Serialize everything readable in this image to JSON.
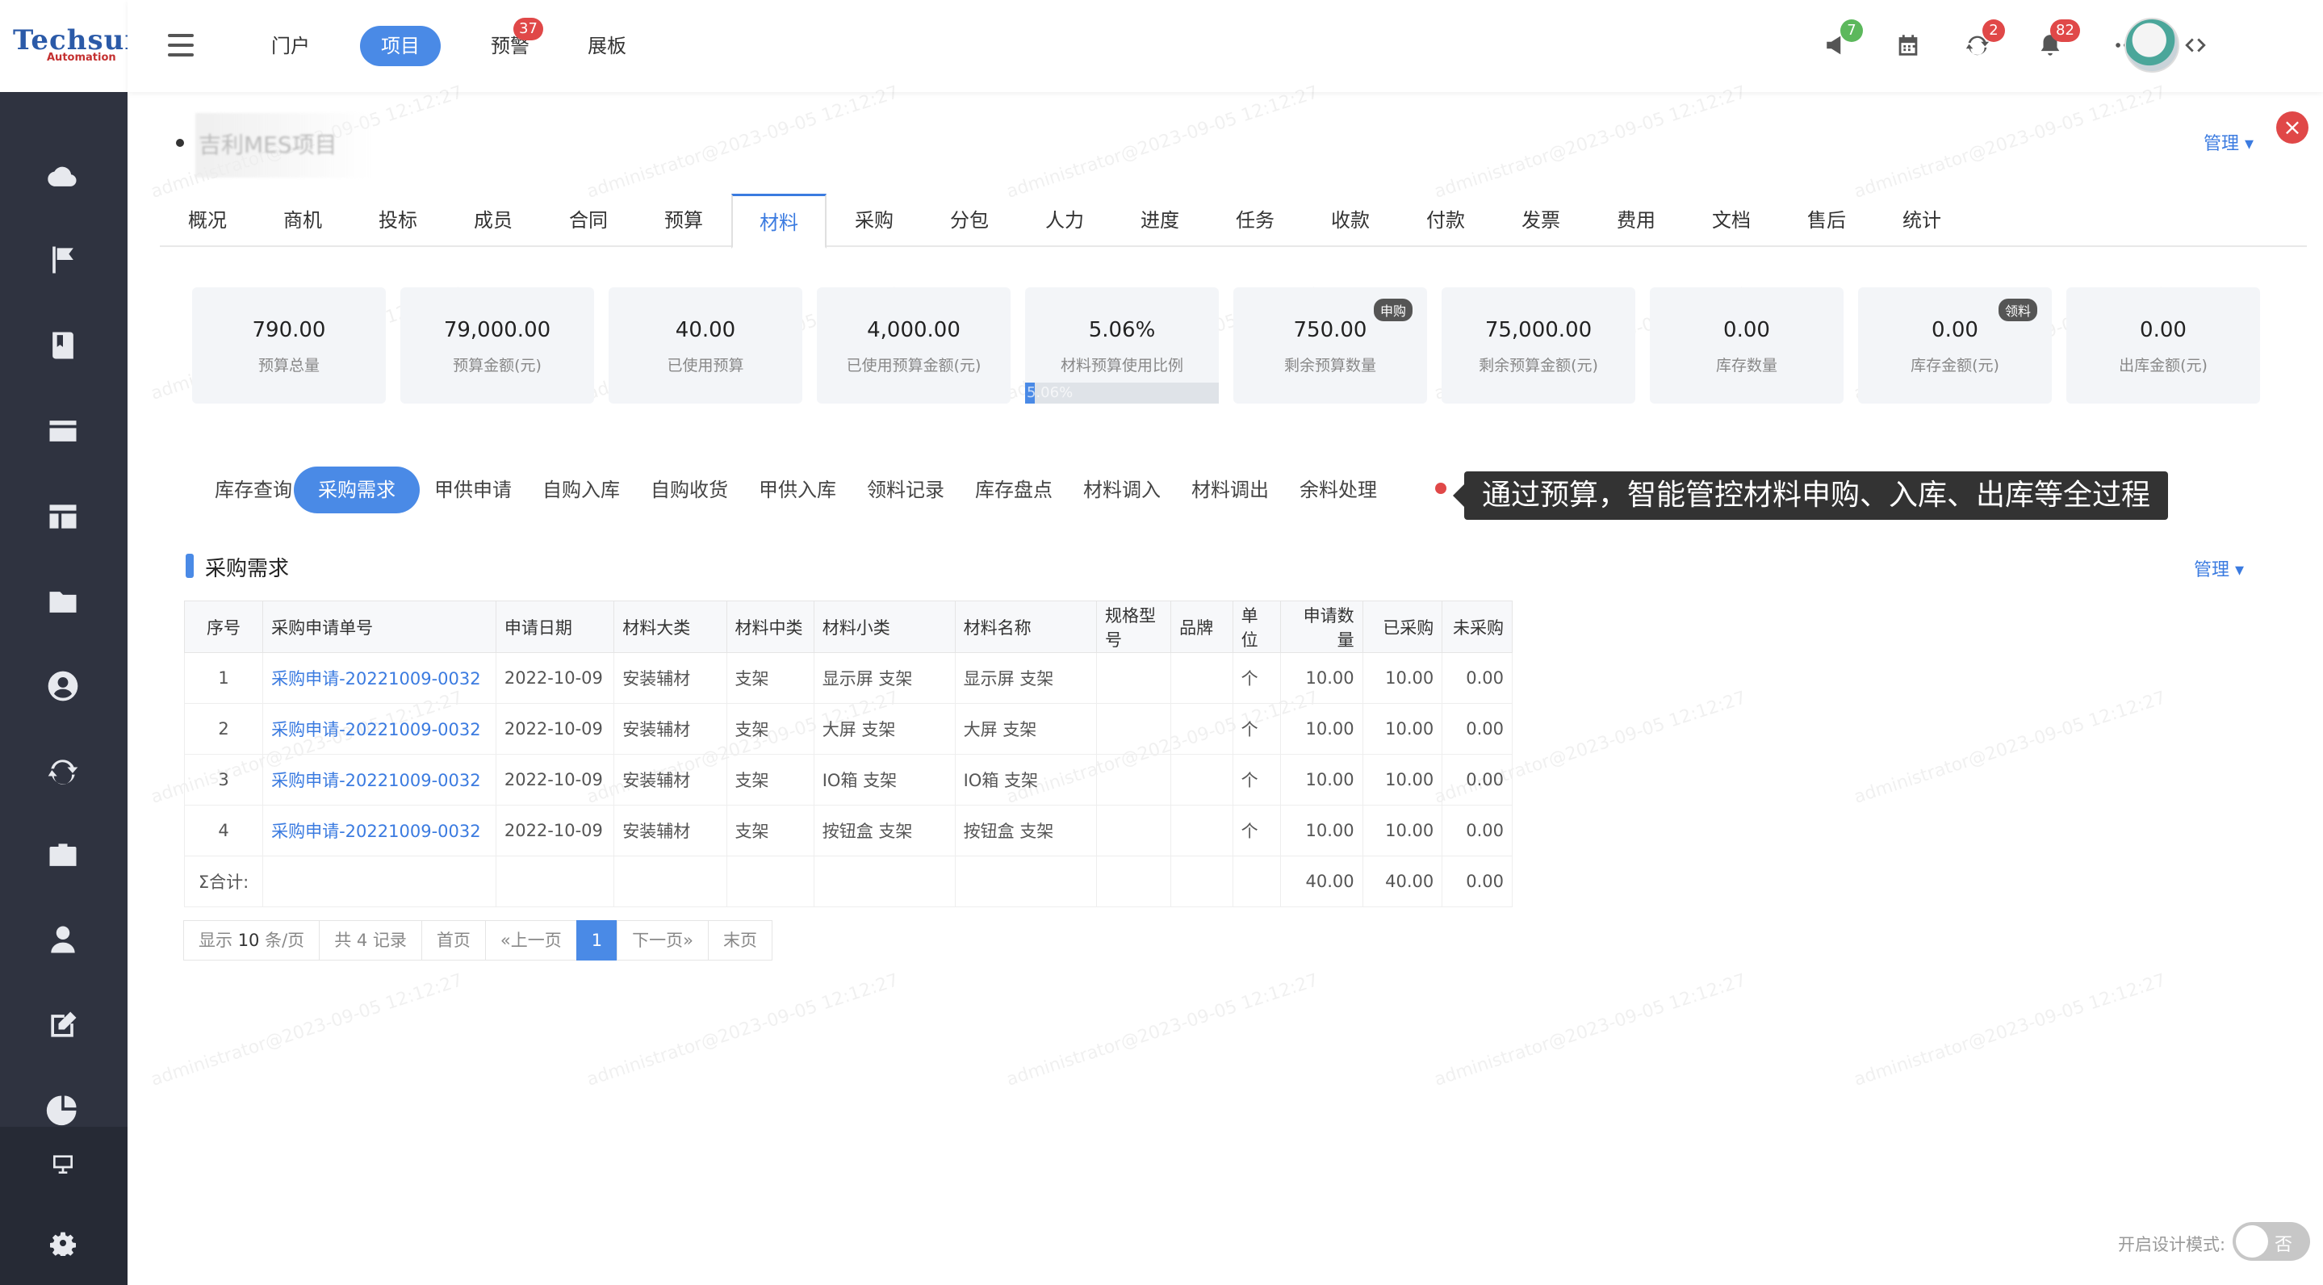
{
  "brand": {
    "logo_text": "Techsun",
    "logo_sub": "Automation"
  },
  "topnav": [
    {
      "label": "门户"
    },
    {
      "label": "项目"
    },
    {
      "label": "预警",
      "badge": "37"
    },
    {
      "label": "展板"
    }
  ],
  "header_badges": {
    "announce": "7",
    "sync": "2",
    "bell": "82"
  },
  "project": {
    "title": "吉利MES项目",
    "manage": "管理"
  },
  "tabs": [
    "概况",
    "商机",
    "投标",
    "成员",
    "合同",
    "预算",
    "材料",
    "采购",
    "分包",
    "人力",
    "进度",
    "任务",
    "收款",
    "付款",
    "发票",
    "费用",
    "文档",
    "售后",
    "统计"
  ],
  "active_tab": "材料",
  "stats": [
    {
      "value": "790.00",
      "label": "预算总量"
    },
    {
      "value": "79,000.00",
      "label": "预算金额(元)"
    },
    {
      "value": "40.00",
      "label": "已使用预算"
    },
    {
      "value": "4,000.00",
      "label": "已使用预算金额(元)"
    },
    {
      "value": "5.06%",
      "label": "材料预算使用比例",
      "progress_text": "5.06%",
      "progress": 0.0506
    },
    {
      "value": "750.00",
      "label": "剩余预算数量",
      "badge": "申购"
    },
    {
      "value": "75,000.00",
      "label": "剩余预算金额(元)"
    },
    {
      "value": "0.00",
      "label": "库存数量"
    },
    {
      "value": "0.00",
      "label": "库存金额(元)",
      "badge": "领料"
    },
    {
      "value": "0.00",
      "label": "出库金额(元)"
    }
  ],
  "subtabs": [
    "库存查询",
    "采购需求",
    "甲供申请",
    "自购入库",
    "自购收货",
    "甲供入库",
    "领料记录",
    "库存盘点",
    "材料调入",
    "材料调出",
    "余料处理"
  ],
  "hint": "通过预算，智能管控材料申购、入库、出库等全过程",
  "section": {
    "title": "采购需求",
    "manage": "管理"
  },
  "table": {
    "headers": [
      "序号",
      "采购申请单号",
      "申请日期",
      "材料大类",
      "材料中类",
      "材料小类",
      "材料名称",
      "规格型号",
      "品牌",
      "单位",
      "申请数量",
      "已采购",
      "未采购"
    ],
    "rows": [
      [
        "1",
        "采购申请-20221009-0032",
        "2022-10-09",
        "安装辅材",
        "支架",
        "显示屏 支架",
        "显示屏 支架",
        "",
        "",
        "个",
        "10.00",
        "10.00",
        "0.00"
      ],
      [
        "2",
        "采购申请-20221009-0032",
        "2022-10-09",
        "安装辅材",
        "支架",
        "大屏 支架",
        "大屏 支架",
        "",
        "",
        "个",
        "10.00",
        "10.00",
        "0.00"
      ],
      [
        "3",
        "采购申请-20221009-0032",
        "2022-10-09",
        "安装辅材",
        "支架",
        "IO箱 支架",
        "IO箱 支架",
        "",
        "",
        "个",
        "10.00",
        "10.00",
        "0.00"
      ],
      [
        "4",
        "采购申请-20221009-0032",
        "2022-10-09",
        "安装辅材",
        "支架",
        "按钮盒 支架",
        "按钮盒 支架",
        "",
        "",
        "个",
        "10.00",
        "10.00",
        "0.00"
      ]
    ],
    "total_label": "Σ合计:",
    "totals": {
      "applied": "40.00",
      "purchased": "40.00",
      "remaining": "0.00"
    }
  },
  "pager": {
    "show": "显示",
    "per_page": "10",
    "unit": "条/页",
    "total": "共 4 记录",
    "first": "首页",
    "prev": "«上一页",
    "current": "1",
    "next": "下一页»",
    "last": "末页"
  },
  "design_mode": {
    "label": "开启设计模式:",
    "toggle": "否"
  },
  "watermark": "administrator@2023-09-05 12:12:27",
  "colors": {
    "accent": "#4a8ae6",
    "badge": "#e04848",
    "sidebar": "#2f3340"
  }
}
